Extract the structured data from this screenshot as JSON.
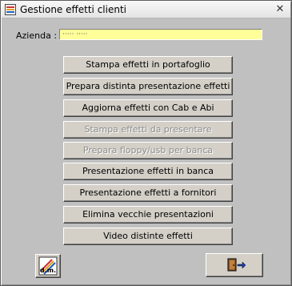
{
  "window": {
    "title": "Gestione effetti clienti",
    "close_glyph": "✕"
  },
  "form": {
    "azienda_label": "Azienda :",
    "azienda_value": "····· ·····"
  },
  "buttons": [
    {
      "label": "Stampa effetti in portafoglio",
      "enabled": true
    },
    {
      "label": "Prepara distinta presentazione effetti",
      "enabled": true
    },
    {
      "label": "Aggiorna effetti con Cab e Abi",
      "enabled": true
    },
    {
      "label": "Stampa effetti da presentare",
      "enabled": false
    },
    {
      "label": "Prepara floppy/usb per banca",
      "enabled": false
    },
    {
      "label": "Presentazione effetti in banca",
      "enabled": true
    },
    {
      "label": "Presentazione effetti a fornitori",
      "enabled": true
    },
    {
      "label": "Elimina vecchie presentazioni",
      "enabled": true
    },
    {
      "label": "Video distinte effetti",
      "enabled": true
    }
  ],
  "footer": {
    "logo_icon": "dm-logo-icon",
    "exit_icon": "exit-door-icon",
    "logo_text": "d.m."
  },
  "colors": {
    "field_background": "#ffff99",
    "disabled_text": "#8e8e8e"
  }
}
